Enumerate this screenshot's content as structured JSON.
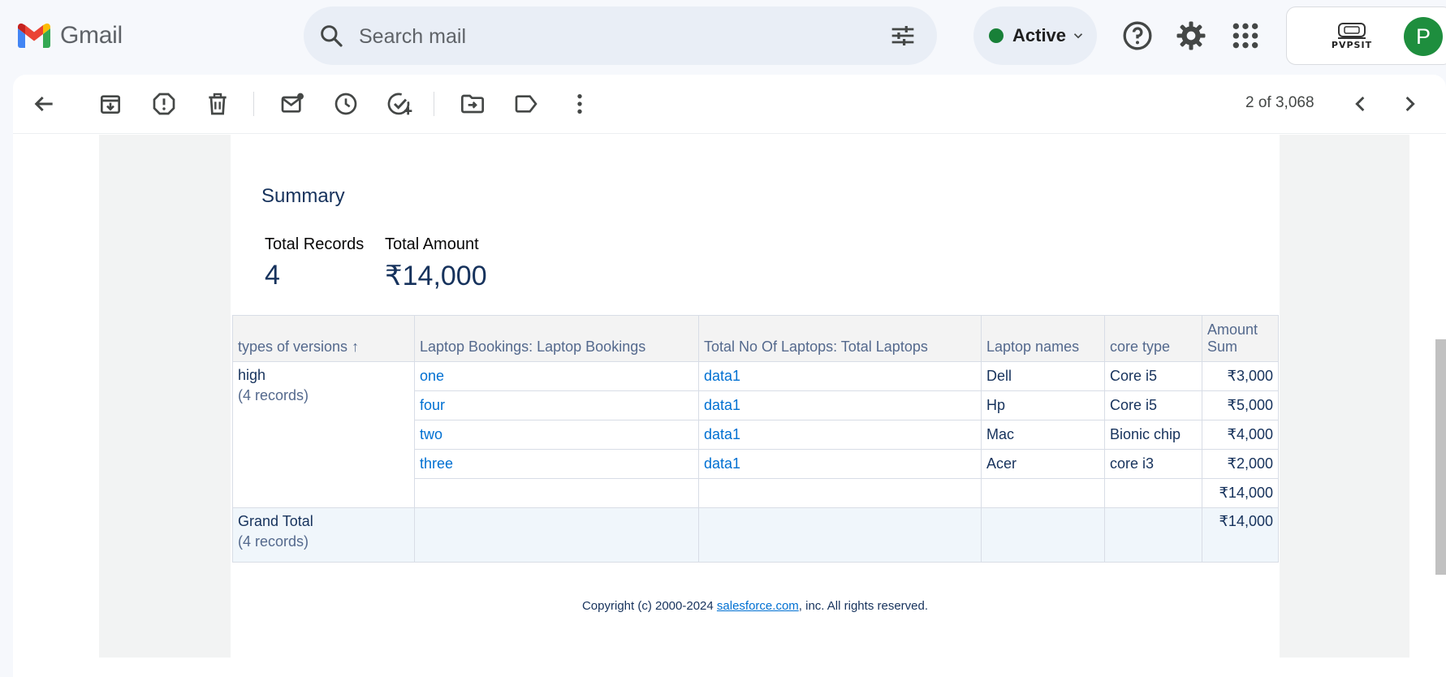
{
  "app": {
    "name": "Gmail"
  },
  "search": {
    "placeholder": "Search mail"
  },
  "status": {
    "label": "Active",
    "color": "#188038"
  },
  "account": {
    "logo_text": "PVPSIT",
    "avatar_letter": "P",
    "avatar_color": "#1e8e3e"
  },
  "toolbar": {
    "icons": [
      "back-arrow-icon",
      "archive-icon",
      "report-spam-icon",
      "delete-icon",
      "mark-unread-icon",
      "snooze-icon",
      "add-task-icon",
      "move-to-icon",
      "label-icon",
      "more-options-icon"
    ],
    "pager_text": "2 of 3,068"
  },
  "report": {
    "summary_title": "Summary",
    "stats": [
      {
        "label": "Total Records",
        "value": "4"
      },
      {
        "label": "Total Amount",
        "value": "₹14,000"
      }
    ],
    "columns": [
      "types of versions ↑",
      "Laptop Bookings: Laptop Bookings",
      "Total No Of Laptops: Total Laptops",
      "Laptop names",
      "core type",
      "Amount Sum"
    ],
    "group": {
      "name": "high",
      "count": "(4 records)"
    },
    "rows": [
      {
        "booking": "one",
        "total": "data1",
        "name": "Dell",
        "core": "Core i5",
        "amount": "₹3,000"
      },
      {
        "booking": "four",
        "total": "data1",
        "name": "Hp",
        "core": "Core i5",
        "amount": "₹5,000"
      },
      {
        "booking": "two",
        "total": "data1",
        "name": "Mac",
        "core": "Bionic chip",
        "amount": "₹4,000"
      },
      {
        "booking": "three",
        "total": "data1",
        "name": "Acer",
        "core": "core i3",
        "amount": "₹2,000"
      }
    ],
    "subtotal": "₹14,000",
    "grand_total": {
      "label": "Grand Total",
      "count": "(4 records)",
      "amount": "₹14,000"
    },
    "footer": {
      "prefix": "Copyright (c) 2000-2024 ",
      "link": "salesforce.com",
      "suffix": ", inc. All rights reserved."
    }
  }
}
